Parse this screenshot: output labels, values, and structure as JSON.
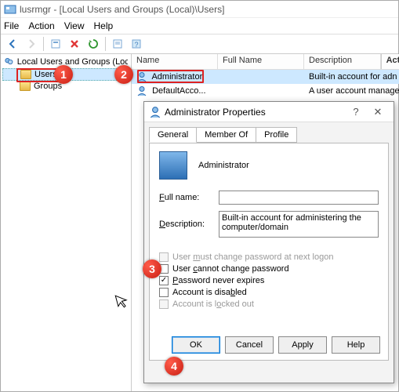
{
  "window": {
    "title": "lusrmgr - [Local Users and Groups (Local)\\Users]"
  },
  "menubar": [
    "File",
    "Action",
    "View",
    "Help"
  ],
  "tree": {
    "root": "Local Users and Groups (Local)",
    "items": [
      "Users",
      "Groups"
    ],
    "selected": 0
  },
  "list": {
    "headers": {
      "name": "Name",
      "full": "Full Name",
      "desc": "Description",
      "act": "Act"
    },
    "rows": [
      {
        "name": "Administrator",
        "full": "",
        "desc": "Built-in account for adn"
      },
      {
        "name": "DefaultAcco...",
        "full": "",
        "desc": "A user account manage"
      }
    ],
    "selected": 0
  },
  "dialog": {
    "title": "Administrator Properties",
    "tabs": [
      "General",
      "Member Of",
      "Profile"
    ],
    "activeTab": 0,
    "username": "Administrator",
    "fields": {
      "fullname_label": "Full name:",
      "fullname_value": "",
      "description_label": "Description:",
      "description_value": "Built-in account for administering the computer/domain"
    },
    "checks": {
      "must_change": {
        "label": "User must change password at next logon",
        "checked": false,
        "enabled": false
      },
      "cannot_change": {
        "label": "User cannot change password",
        "checked": false,
        "enabled": true
      },
      "never_expires": {
        "label": "Password never expires",
        "checked": true,
        "enabled": true
      },
      "disabled": {
        "label": "Account is disabled",
        "checked": false,
        "enabled": true
      },
      "locked": {
        "label": "Account is locked out",
        "checked": false,
        "enabled": false
      }
    },
    "buttons": {
      "ok": "OK",
      "cancel": "Cancel",
      "apply": "Apply",
      "help": "Help"
    }
  },
  "markers": {
    "1": "1",
    "2": "2",
    "3": "3",
    "4": "4"
  }
}
